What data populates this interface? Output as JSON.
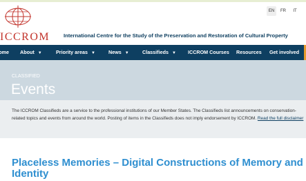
{
  "logo": {
    "text": "ICCROM"
  },
  "languages": [
    {
      "code": "EN",
      "active": true
    },
    {
      "code": "FR",
      "active": false
    },
    {
      "code": "IT",
      "active": false
    }
  ],
  "header": {
    "tagline": "International Centre for the Study of the Preservation and Restoration of Cultural Property"
  },
  "nav": {
    "items": [
      {
        "label": "Home",
        "dropdown": false
      },
      {
        "label": "About",
        "dropdown": true
      },
      {
        "label": "Priority areas",
        "dropdown": true
      },
      {
        "label": "News",
        "dropdown": true
      },
      {
        "label": "Classifieds",
        "dropdown": true
      },
      {
        "label": "ICCROM Courses",
        "dropdown": false
      },
      {
        "label": "Resources",
        "dropdown": false
      },
      {
        "label": "Get involved",
        "dropdown": false
      }
    ]
  },
  "hero": {
    "eyebrow": "CLASSIFIED",
    "title": "Events"
  },
  "notice": {
    "text": "The ICCROM Classifieds are a service to the professional institutions of our Member States. The Classifieds list announcements on conservation-related topics and events from around the world. Posting of items in the Classifieds does not imply endorsement by ICCROM. ",
    "link": "Read the full disclaimer"
  },
  "article": {
    "title": "Placeless Memories – Digital Constructions of Memory and Identity"
  },
  "colors": {
    "nav_bg": "#0e3f61",
    "hero_bg": "#ccd8e0",
    "title_blue": "#2f8fd0",
    "logo_red": "#c2332b"
  }
}
